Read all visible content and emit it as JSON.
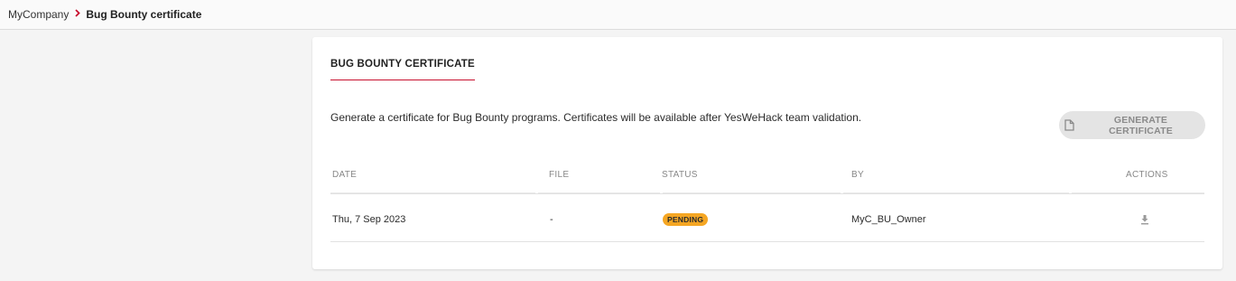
{
  "breadcrumb": {
    "root": "MyCompany",
    "separator_icon": "chevron-right-icon",
    "current": "Bug Bounty certificate"
  },
  "card": {
    "title": "BUG BOUNTY CERTIFICATE",
    "description": "Generate a certificate for Bug Bounty programs. Certificates will be available after YesWeHack team validation.",
    "generate_button": {
      "label": "GENERATE CERTIFICATE",
      "icon": "document-icon",
      "state": "disabled"
    }
  },
  "table": {
    "headers": {
      "date": "DATE",
      "file": "FILE",
      "status": "STATUS",
      "by": "BY",
      "actions": "ACTIONS"
    },
    "rows": [
      {
        "date": "Thu, 7 Sep 2023",
        "file": "-",
        "status": "PENDING",
        "by": "MyC_BU_Owner",
        "action_icon": "download-icon"
      }
    ]
  },
  "colors": {
    "accent": "#c8102e",
    "pending_badge": "#f5a623",
    "button_bg": "#e4e4e4"
  }
}
